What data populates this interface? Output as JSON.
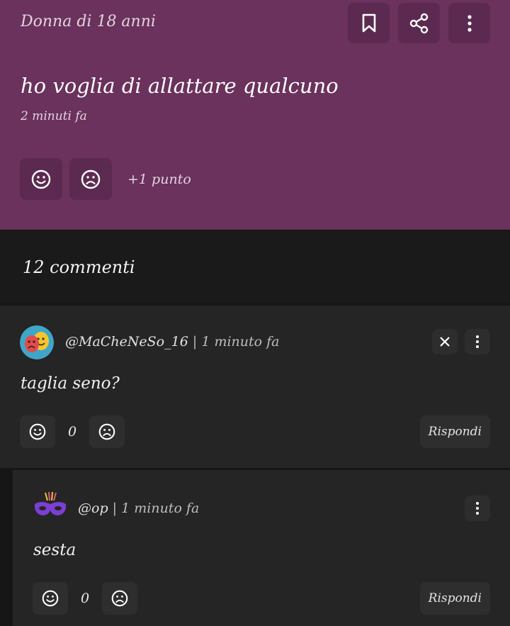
{
  "post": {
    "author": "Donna di 18 anni",
    "body": "ho voglia di allattare qualcuno",
    "time": "2 minuti fa",
    "points": "+1 punto",
    "icons": [
      "bookmark-icon",
      "share-icon",
      "more-vertical-icon",
      "smile-icon",
      "frown-icon"
    ]
  },
  "comments": {
    "count_label": "12 commenti"
  },
  "comment1": {
    "username": "@MaCheNeSo_16",
    "separator": "|",
    "time": "1 minuto fa",
    "text": "taglia seno?",
    "score": "0",
    "reply_label": "Rispondi",
    "avatar": "theater-masks-avatar"
  },
  "reply1": {
    "username": "@op",
    "separator": "|",
    "time": "1 minuto fa",
    "text": "sesta",
    "score": "0",
    "reply_label": "Rispondi",
    "avatar": "purple-mask-avatar"
  },
  "colors": {
    "post_bg": "#6a325c",
    "page_bg": "#161616",
    "card_bg": "#252525"
  }
}
